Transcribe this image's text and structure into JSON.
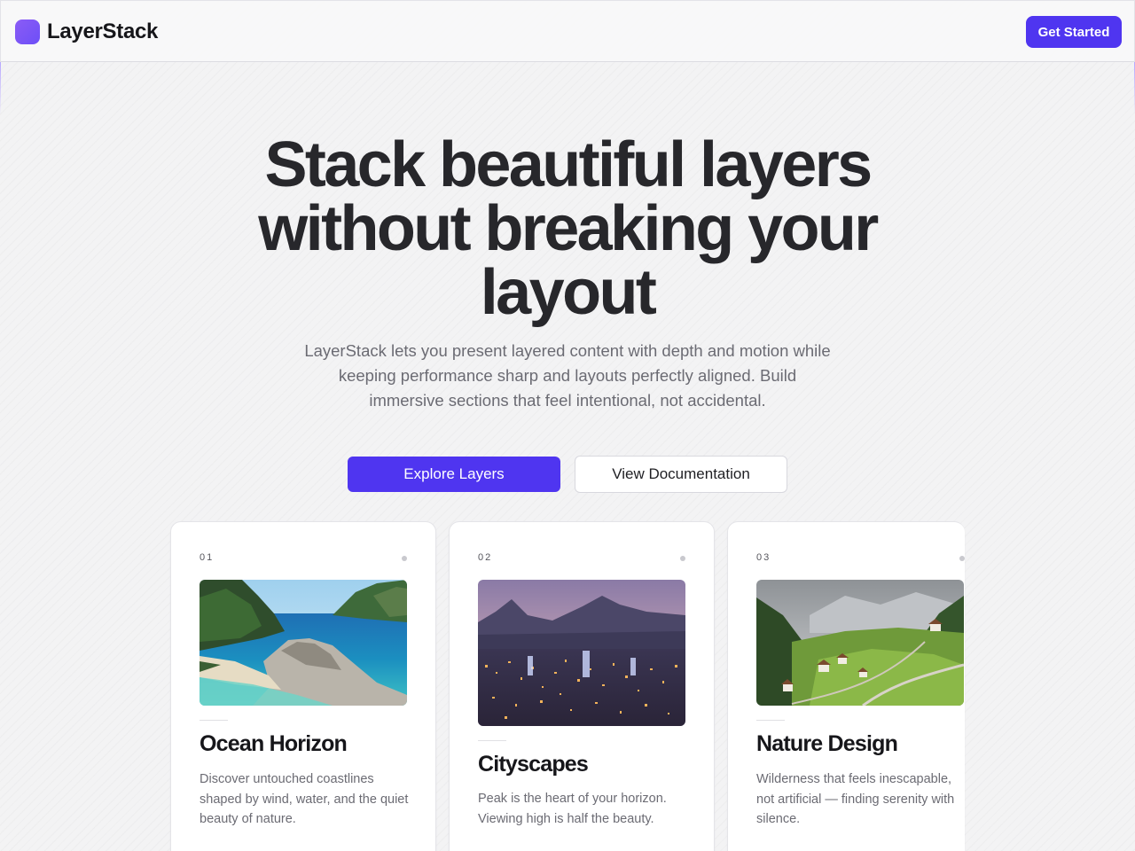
{
  "brand": {
    "name": "LayerStack",
    "logo_icon": "logo-square-icon",
    "accent": "#4f35f0",
    "logo_color": "#7c5cff"
  },
  "nav": {
    "cta_label": "Get Started"
  },
  "hero": {
    "title": "Stack beautiful layers without breaking your layout",
    "subtitle": "LayerStack lets you present layered content with depth and motion while keeping performance sharp and layouts perfectly aligned. Build immersive sections that feel intentional, not accidental.",
    "primary_label": "Explore Layers",
    "secondary_label": "View Documentation"
  },
  "cards": [
    {
      "number": "01",
      "title": "Ocean Horizon",
      "description": "Discover untouched coastlines shaped by wind, water, and the quiet beauty of nature.",
      "image": "ocean-coastline-image"
    },
    {
      "number": "02",
      "title": "Cityscapes",
      "description": "Peak is the heart of your horizon. Viewing high is half the beauty.",
      "image": "city-night-image"
    },
    {
      "number": "03",
      "title": "Nature Design",
      "description": "Wilderness that feels inescapable, not artificial — finding serenity with silence.",
      "image": "alpine-valley-image"
    }
  ]
}
